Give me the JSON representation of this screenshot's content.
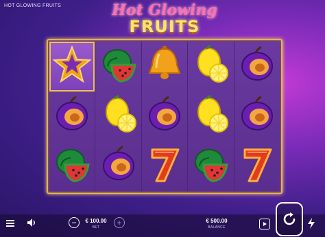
{
  "game": {
    "window_title": "HOT GLOWING FRUITS",
    "logo_line1": "Hot Glowing",
    "logo_line2": "FRUITS"
  },
  "reels": [
    [
      "star",
      "plum",
      "watermelon"
    ],
    [
      "watermelon",
      "lemon",
      "plum"
    ],
    [
      "bell",
      "plum",
      "seven"
    ],
    [
      "lemon",
      "lemon",
      "watermelon"
    ],
    [
      "plum",
      "plum",
      "seven"
    ]
  ],
  "highlighted_cell": {
    "reel": 0,
    "row": 0,
    "symbol": "star"
  },
  "controls": {
    "bet_value": "€ 100.00",
    "bet_label": "BET",
    "balance_value": "€ 500.00",
    "balance_label": "BALANCE",
    "minus_symbol": "−",
    "plus_symbol": "+",
    "icons": [
      "menu-icon",
      "sound-icon",
      "minus-icon",
      "plus-icon",
      "autoplay-icon",
      "spin-icon",
      "turbo-icon"
    ]
  },
  "colors": {
    "frame_gold": "#e7b34a",
    "reel_purple": "#6a3aa0",
    "logo_pink": "#ff6fb4",
    "logo_yellow": "#ffe36a"
  }
}
